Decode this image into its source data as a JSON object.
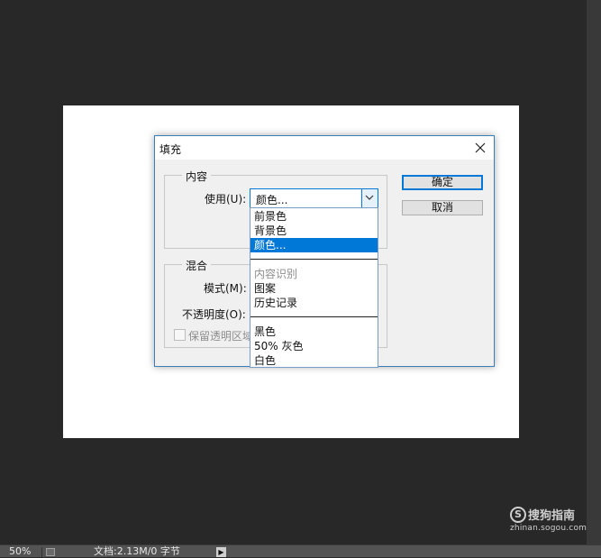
{
  "dialog": {
    "title": "填充",
    "ok_label": "确定",
    "cancel_label": "取消",
    "content_group": {
      "label": "内容",
      "use_label": "使用(U):",
      "use_value": "颜色..."
    },
    "blend_group": {
      "label": "混合",
      "mode_label": "模式(M):",
      "opacity_label": "不透明度(O):",
      "preserve_label": "保留透明区域"
    }
  },
  "dropdown": {
    "options": [
      {
        "label": "前景色",
        "state": "normal"
      },
      {
        "label": "背景色",
        "state": "normal"
      },
      {
        "label": "颜色...",
        "state": "selected"
      },
      {
        "label": "",
        "state": "separator"
      },
      {
        "label": "内容识别",
        "state": "disabled"
      },
      {
        "label": "图案",
        "state": "normal"
      },
      {
        "label": "历史记录",
        "state": "normal"
      },
      {
        "label": "",
        "state": "separator"
      },
      {
        "label": "黑色",
        "state": "normal"
      },
      {
        "label": "50% 灰色",
        "state": "normal"
      },
      {
        "label": "白色",
        "state": "normal"
      }
    ]
  },
  "statusbar": {
    "zoom": "50%",
    "doc_info": "文档:2.13M/0 字节"
  },
  "watermark": {
    "name": "搜狗指南",
    "url": "zhinan.sogou.com"
  },
  "colors": {
    "accent": "#0078d7",
    "workspace": "#282828",
    "dialog_bg": "#f0f0f0"
  },
  "icons": {
    "close": "close-icon",
    "dropdown_arrow": "chevron-down-icon"
  }
}
